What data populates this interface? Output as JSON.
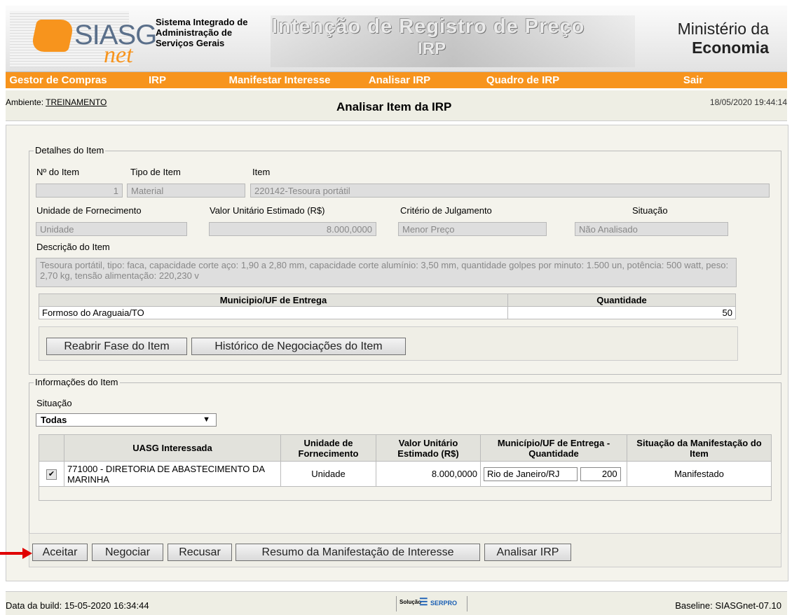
{
  "header": {
    "logo_siasg": "SIASG",
    "logo_net": "net",
    "system_name": [
      "Sistema Integrado de",
      "Administração de",
      "Serviços Gerais"
    ],
    "banner_line1": "Intenção de Registro de Preço",
    "banner_line2": "IRP",
    "ministry_line1": "Ministério da",
    "ministry_line2": "Economia"
  },
  "menu": [
    {
      "label": "Gestor de Compras"
    },
    {
      "label": "IRP"
    },
    {
      "label": "Manifestar Interesse"
    },
    {
      "label": "Analisar IRP"
    },
    {
      "label": "Quadro de IRP"
    },
    {
      "label": "Sair"
    }
  ],
  "infobar": {
    "ambiente_label": "Ambiente: ",
    "ambiente_value": "TREINAMENTO",
    "page_title": "Analisar Item da IRP",
    "datetime": "18/05/2020 19:44:14"
  },
  "detalhes": {
    "legend": "Detalhes do Item",
    "numero_label": "Nº do Item",
    "numero_value": "1",
    "tipo_label": "Tipo de Item",
    "tipo_value": "Material",
    "item_label": "Item",
    "item_value": "220142-Tesoura portátil",
    "unidade_label": "Unidade de Fornecimento",
    "unidade_value": "Unidade",
    "valor_label": "Valor Unitário Estimado (R$)",
    "valor_value": "8.000,0000",
    "criterio_label": "Critério de Julgamento",
    "criterio_value": "Menor Preço",
    "situacao_label": "Situação",
    "situacao_value": "Não Analisado",
    "descricao_label": "Descrição do Item",
    "descricao_value": "Tesoura portátil, tipo: faca, capacidade corte aço: 1,90 a 2,80 mm, capacidade corte alumínio: 3,50 mm, quantidade golpes por minuto: 1.500 un, potência: 500 watt, peso: 2,70 kg, tensão alimentação: 220,230 v",
    "entrega_headers": [
      "Municipio/UF de Entrega",
      "Quantidade"
    ],
    "entrega_rows": [
      [
        "Formoso do Araguaia/TO",
        "50"
      ]
    ],
    "btn_reabrir": "Reabrir Fase do Item",
    "btn_historico": "Histórico de Negociações do Item"
  },
  "informacoes": {
    "legend": "Informações do Item",
    "situacao_label": "Situação",
    "situacao_select": "Todas",
    "headers": [
      "UASG Interessada",
      "Unidade de Fornecimento",
      "Valor Unitário Estimado (R$)",
      "Município/UF de Entrega - Quantidade",
      "Situação da Manifestação do Item"
    ],
    "rows": [
      {
        "checked": "✔",
        "uasg": "771000 - DIRETORIA DE ABASTECIMENTO DA MARINHA",
        "unidade": "Unidade",
        "valor": "8.000,0000",
        "municipio": "Rio de Janeiro/RJ",
        "quantidade": "200",
        "situacao": "Manifestado"
      }
    ]
  },
  "actions": {
    "aceitar": "Aceitar",
    "negociar": "Negociar",
    "recusar": "Recusar",
    "resumo": "Resumo da Manifestação de Interesse",
    "analisar": "Analisar IRP"
  },
  "footer": {
    "build": "Data da build: 15-05-2020 16:34:44",
    "solucao": "Solução",
    "serpro": "SERPRO",
    "baseline": "Baseline: SIASGnet-07.10"
  },
  "colors": {
    "menu_orange": "#f7941d",
    "panel_bg": "#f4f3ec",
    "arrow_red": "#e00000"
  }
}
